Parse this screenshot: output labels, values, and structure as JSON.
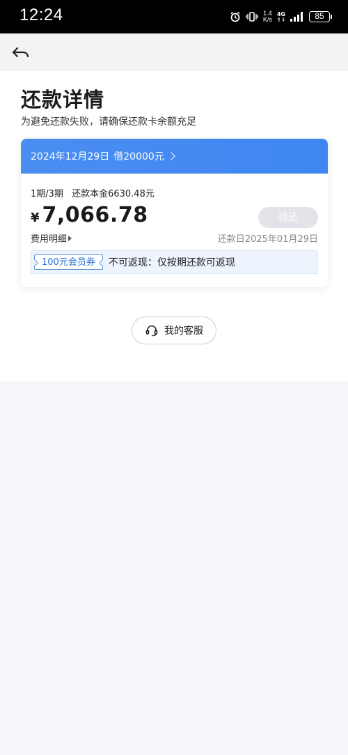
{
  "status_bar": {
    "time": "12:24",
    "net_speed_value": "1.4",
    "net_speed_unit": "K/s",
    "network_type": "4G",
    "battery": "85"
  },
  "page": {
    "title": "还款详情",
    "subtitle": "为避免还款失败，请确保还款卡余额充足"
  },
  "card": {
    "loan_date": "2024年12月29日",
    "loan_amount": "借20000元",
    "period": "1期/3期",
    "principal": "还款本金6630.48元",
    "currency_symbol": "¥",
    "amount": "7,066.78",
    "status": "待还",
    "fee_detail_label": "费用明细",
    "due_date": "还款日2025年01月29日",
    "coupon_label": "100元会员券",
    "coupon_note": "不可返现：仅按期还款可返现"
  },
  "service": {
    "label": "我的客服"
  },
  "colors": {
    "accent": "#4a8ef2",
    "coupon_text": "#2a6fd6",
    "status_pill_bg": "#e3e4ea"
  },
  "icons": {
    "back": "back-arrow-icon",
    "header_chevron": "chevron-right-icon",
    "fee_detail": "triangle-right-icon",
    "service": "headset-icon",
    "status_bar": [
      "alarm-icon",
      "vibrate-icon",
      "signal-icon",
      "battery-icon"
    ]
  }
}
